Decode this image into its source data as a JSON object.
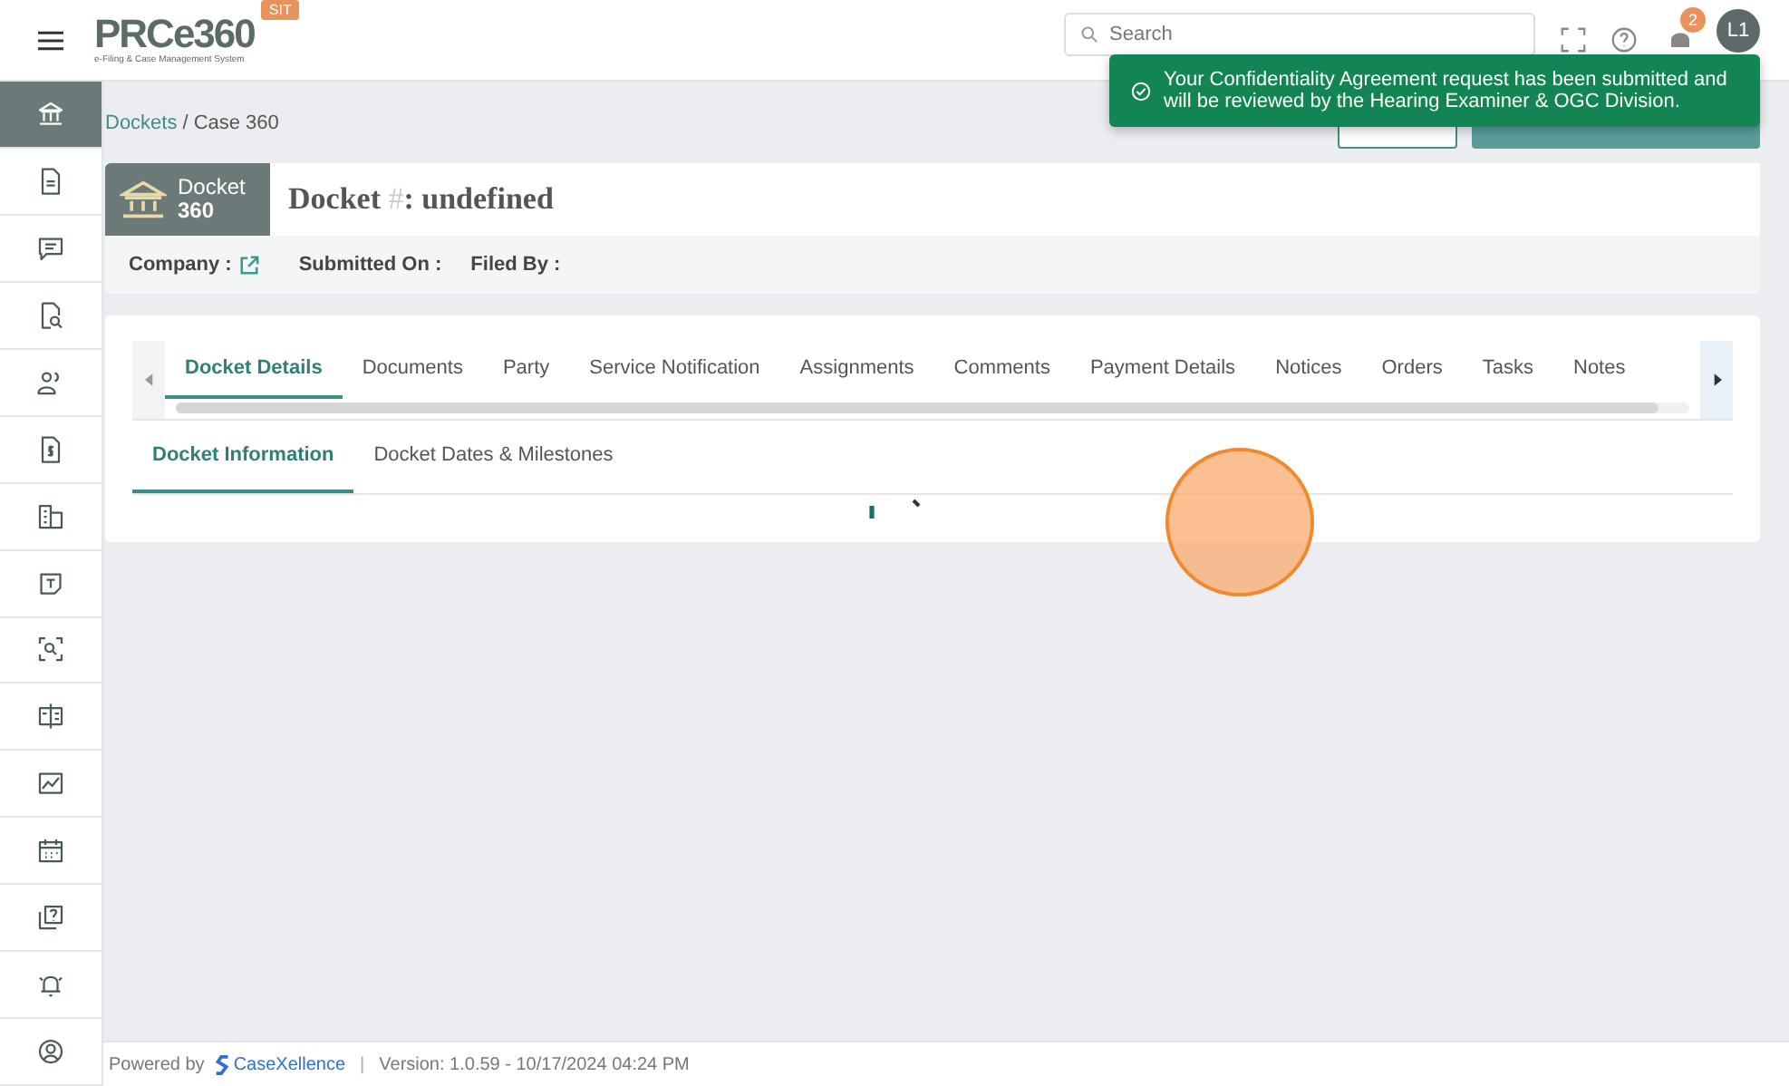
{
  "header": {
    "logo": "PRCe360",
    "logo_subtitle": "e-Filing & Case Management System",
    "env_badge": "SIT",
    "search": {
      "placeholder": "Search"
    },
    "notification_count": "2",
    "avatar": "L1"
  },
  "sidebar": {
    "items": [
      {
        "selected": true
      },
      {
        "selected": false
      },
      {
        "selected": false
      },
      {
        "selected": false
      },
      {
        "selected": false
      },
      {
        "selected": false
      },
      {
        "selected": false
      },
      {
        "selected": false
      },
      {
        "selected": false
      },
      {
        "selected": false
      },
      {
        "selected": false
      },
      {
        "selected": false
      },
      {
        "selected": false
      },
      {
        "selected": false
      },
      {
        "selected": false
      }
    ]
  },
  "breadcrumb": {
    "items": [
      "Dockets",
      "Case 360"
    ],
    "separator": "/"
  },
  "docket": {
    "badge_label": "Docket",
    "badge_number": "360",
    "title_start": "Docket",
    "title_mark": "#",
    "title_end": ": undefined",
    "meta": [
      {
        "label": "Company :",
        "link_icon": true
      },
      {
        "label": "Submitted On :",
        "link_icon": false
      },
      {
        "label": "Filed By :",
        "link_icon": false
      }
    ]
  },
  "tabs": [
    {
      "label": "Docket Details",
      "selected": true
    },
    {
      "label": "Documents",
      "selected": false
    },
    {
      "label": "Party",
      "selected": false
    },
    {
      "label": "Service Notification",
      "selected": false
    },
    {
      "label": "Assignments",
      "selected": false
    },
    {
      "label": "Comments",
      "selected": false
    },
    {
      "label": "Payment Details",
      "selected": false
    },
    {
      "label": "Notices",
      "selected": false
    },
    {
      "label": "Orders",
      "selected": false
    },
    {
      "label": "Tasks",
      "selected": false
    },
    {
      "label": "Notes",
      "selected": false
    }
  ],
  "subtabs": [
    {
      "label": "Docket Information",
      "selected": true
    },
    {
      "label": "Docket Dates & Milestones",
      "selected": false
    }
  ],
  "toast": {
    "message": "Your Confidentiality Agreement request has been submitted and will be reviewed by the Hearing Examiner & OGC Division."
  },
  "footer": {
    "powered_by": "Powered by",
    "brand": "CaseXellence",
    "separator": "|",
    "version": "Version: 1.0.59 - 10/17/2024 04:24 PM"
  }
}
